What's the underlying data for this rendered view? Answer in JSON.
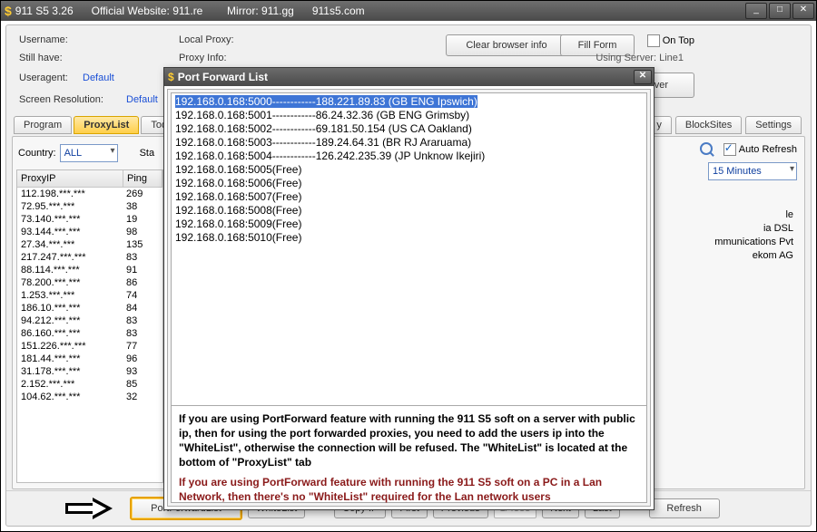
{
  "window": {
    "title": "911 S5 3.26      Official Website: 911.re        Mirror: 911.gg      911s5.com",
    "min": "_",
    "max": "□",
    "close": "✕"
  },
  "top": {
    "username_lbl": "Username:",
    "local_proxy_lbl": "Local Proxy:",
    "clear_btn": "Clear browser info",
    "fillform_btn": "Fill Form",
    "ontop_lbl": "On Top",
    "stillhave_lbl": "Still have:",
    "proxy_info_lbl": "Proxy Info:",
    "using_server_lbl": "Using Server: Line1",
    "useragent_lbl": "Useragent:",
    "useragent_val": "Default",
    "change_server_btn": "Change Server",
    "screenres_lbl": "Screen Resolution:",
    "screenres_val": "Default"
  },
  "tabs": {
    "program": "Program",
    "proxylist": "ProxyList",
    "tod": "Tod",
    "right_y": "y",
    "blocksites": "BlockSites",
    "settings": "Settings"
  },
  "filter": {
    "country_lbl": "Country:",
    "country_val": "ALL",
    "sta_lbl": "Sta",
    "autorefresh_lbl": "Auto Refresh",
    "interval": "15 Minutes"
  },
  "table": {
    "h1": "ProxyIP",
    "h2": "Ping",
    "rows": [
      {
        "ip": "112.198.***.***",
        "ping": "269"
      },
      {
        "ip": "72.95.***.***",
        "ping": "38"
      },
      {
        "ip": "73.140.***.***",
        "ping": "19"
      },
      {
        "ip": "93.144.***.***",
        "ping": "98"
      },
      {
        "ip": "27.34.***.***",
        "ping": "135"
      },
      {
        "ip": "217.247.***.***",
        "ping": "83"
      },
      {
        "ip": "88.114.***.***",
        "ping": "91"
      },
      {
        "ip": "78.200.***.***",
        "ping": "86"
      },
      {
        "ip": "1.253.***.***",
        "ping": "74"
      },
      {
        "ip": "186.10.***.***",
        "ping": "84"
      },
      {
        "ip": "94.212.***.***",
        "ping": "83"
      },
      {
        "ip": "86.160.***.***",
        "ping": "83"
      },
      {
        "ip": "151.226.***.***",
        "ping": "77"
      },
      {
        "ip": "181.44.***.***",
        "ping": "96"
      },
      {
        "ip": "31.178.***.***",
        "ping": "93"
      },
      {
        "ip": "2.152.***.***",
        "ping": "85"
      },
      {
        "ip": "104.62.***.***",
        "ping": "32"
      }
    ]
  },
  "right_frag": {
    "l1": "le",
    "l2": "ia DSL",
    "l3": "mmunications Pvt",
    "l4": "ekom AG"
  },
  "bottom": {
    "portforward": "PortForwardList",
    "whitelist": "WhiteList",
    "copyip": "Copy IP",
    "first": "First",
    "previous": "Previous",
    "pages": "1/4383",
    "next": "Next",
    "last": "Last",
    "refresh": "Refresh"
  },
  "modal": {
    "title": "Port Forward List",
    "close": "✕",
    "lines": [
      "192.168.0.168:5000------------188.221.89.83 (GB ENG Ipswich)",
      "192.168.0.168:5001------------86.24.32.36 (GB ENG Grimsby)",
      "192.168.0.168:5002------------69.181.50.154 (US CA Oakland)",
      "192.168.0.168:5003------------189.24.64.31 (BR RJ Araruama)",
      "192.168.0.168:5004------------126.242.235.39 (JP Unknow Ikejiri)",
      "192.168.0.168:5005(Free)",
      "192.168.0.168:5006(Free)",
      "192.168.0.168:5007(Free)",
      "192.168.0.168:5008(Free)",
      "192.168.0.168:5009(Free)",
      "192.168.0.168:5010(Free)"
    ],
    "note1": "If you are using PortForward feature with running the 911 S5 soft on a server with public ip, then for using the port forwarded proxies, you need to add the users ip into the \"WhiteList\", otherwise the connection will be refused. The \"WhiteList\" is located at the bottom of \"ProxyList\" tab",
    "note2": "If you are using PortForward feature with running the 911 S5 soft on a PC in a Lan Network, then there's no \"WhiteList\" required for the Lan network users"
  }
}
